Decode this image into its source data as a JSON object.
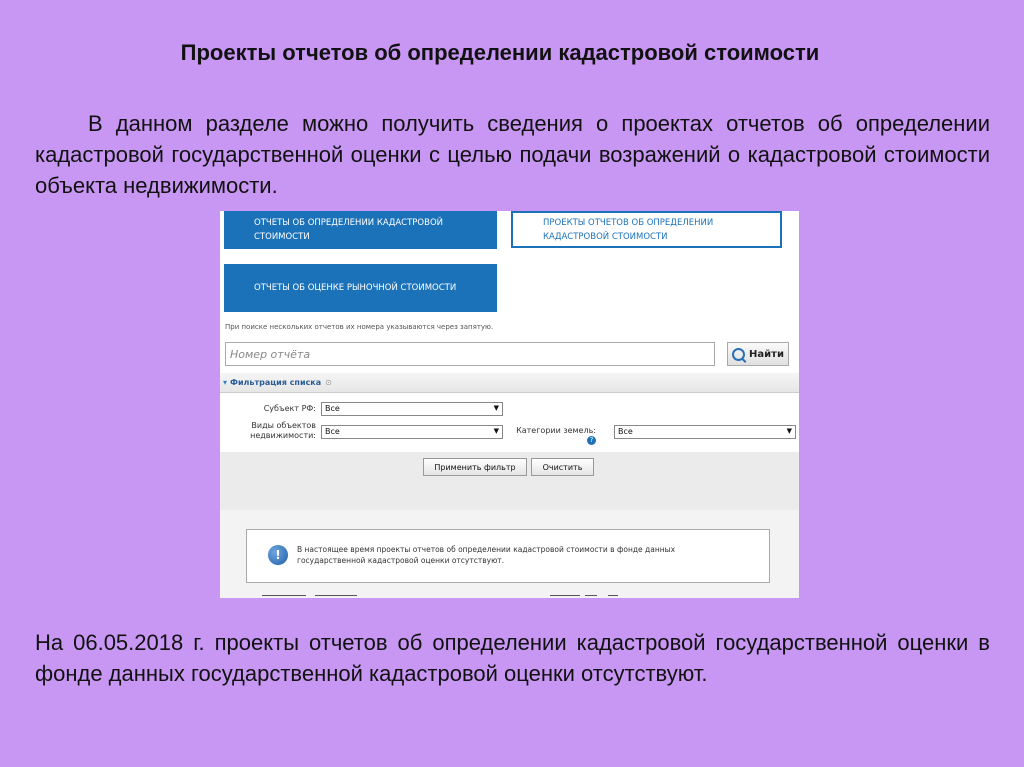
{
  "slide": {
    "title": "Проекты отчетов об определении кадастровой стоимости",
    "intro": "В данном разделе можно получить сведения о проектах отчетов об определении кадастровой государственной оценки с целью подачи возражений о кадастровой стоимости объекта недвижимости.",
    "conclusion": "На 06.05.2018 г. проекты отчетов об определении кадастровой государственной оценки в фонде данных государственной кадастровой оценки отсутствуют."
  },
  "screenshot": {
    "tiles": [
      "отчеты об определении кадастровой стоимости",
      "проекты отчетов об определении кадастровой стоимости",
      "отчеты об оценке рыночной стоимости"
    ],
    "search": {
      "hint": "При поиске нескольких отчетов их номера указываются через запятую.",
      "placeholder": "Номер отчёта",
      "button": "Найти"
    },
    "filter": {
      "title": "Фильтрация списка",
      "subject_label": "Субъект РФ:",
      "subject_value": "Все",
      "object_types_label": "Виды объектов недвижимости:",
      "object_types_value": "Все",
      "land_categories_label": "Категории земель:",
      "land_categories_value": "Все",
      "apply_button": "Применить фильтр",
      "clear_button": "Очистить"
    },
    "message": "В настоящее время проекты отчетов об определении кадастровой стоимости в фонде данных государственной кадастровой оценки отсутствуют."
  },
  "colors": {
    "background": "#c897f4",
    "tile_blue": "#1c72b9"
  },
  "icons": {
    "search": "magnifier-icon",
    "info": "exclamation-circle-icon",
    "help": "question-circle-icon"
  }
}
